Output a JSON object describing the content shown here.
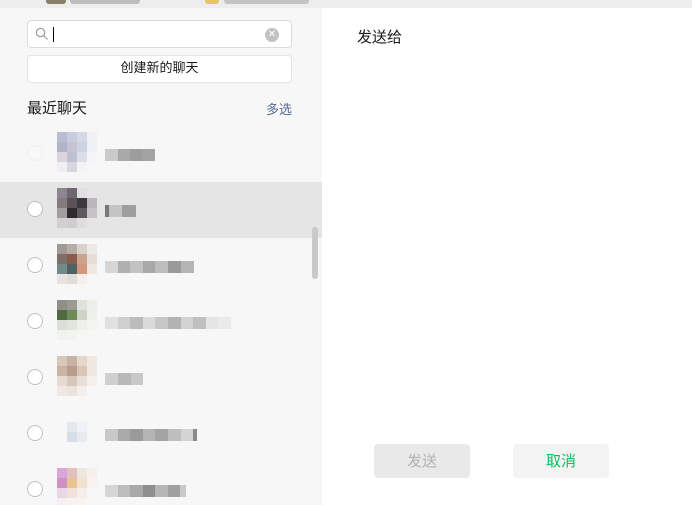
{
  "search": {
    "value": "",
    "clear_icon": "clear-icon"
  },
  "create_new_chat_label": "创建新的聊天",
  "recent_title": "最近聊天",
  "multi_select_label": "多选",
  "right_panel": {
    "title": "发送给"
  },
  "buttons": {
    "send_label": "发送",
    "cancel_label": "取消"
  },
  "colors": {
    "accent_green": "#07c160",
    "link_blue": "#576b95"
  }
}
